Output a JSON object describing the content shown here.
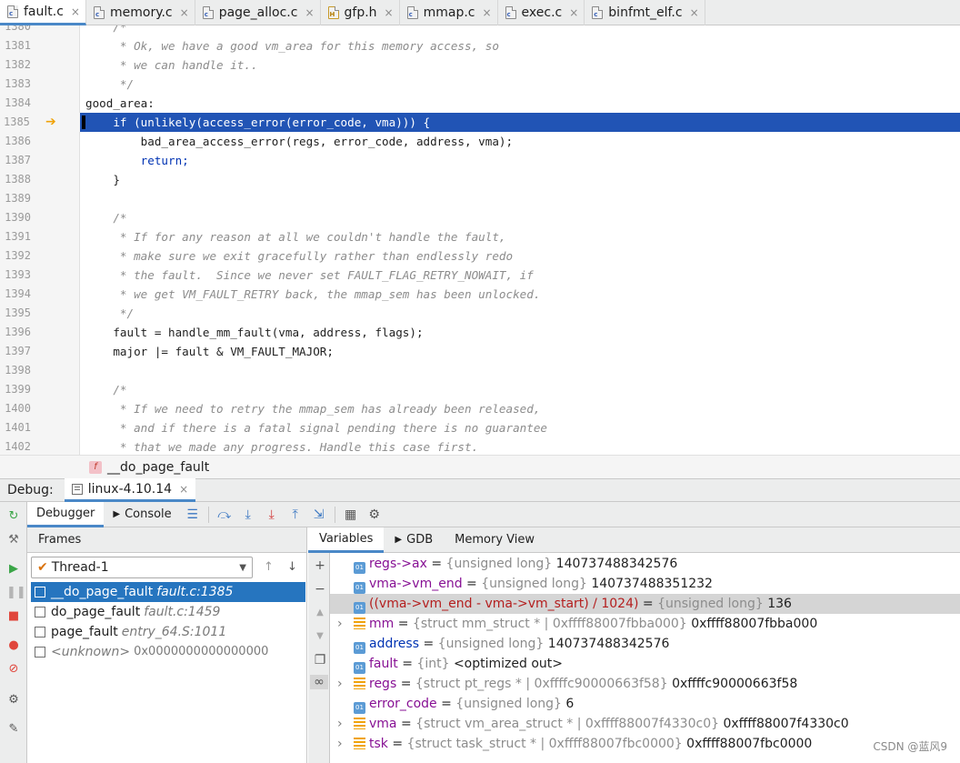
{
  "tabs": [
    {
      "label": "fault.c",
      "icon": "c-file-icon",
      "active": true
    },
    {
      "label": "memory.c",
      "icon": "c-file-icon"
    },
    {
      "label": "page_alloc.c",
      "icon": "c-file-icon"
    },
    {
      "label": "gfp.h",
      "icon": "h-file-icon"
    },
    {
      "label": "mmap.c",
      "icon": "c-file-icon"
    },
    {
      "label": "exec.c",
      "icon": "c-file-icon"
    },
    {
      "label": "binfmt_elf.c",
      "icon": "c-file-icon"
    }
  ],
  "tab_close": "×",
  "editor": {
    "lines": [
      {
        "n": "1380",
        "text": "    /*",
        "kind": "cm"
      },
      {
        "n": "1381",
        "text": "     * Ok, we have a good vm_area for this memory access, so",
        "kind": "cm"
      },
      {
        "n": "1382",
        "text": "     * we can handle it..",
        "kind": "cm"
      },
      {
        "n": "1383",
        "text": "     */",
        "kind": "cm"
      },
      {
        "n": "1384",
        "text": "good_area:",
        "kind": "code"
      },
      {
        "n": "1385",
        "text": "    if (unlikely(access_error(error_code, vma))) {",
        "kind": "code",
        "current": true
      },
      {
        "n": "1386",
        "text": "        bad_area_access_error(regs, error_code, address, vma);",
        "kind": "code"
      },
      {
        "n": "1387",
        "text": "        return;",
        "kind": "kw"
      },
      {
        "n": "1388",
        "text": "    }",
        "kind": "code"
      },
      {
        "n": "1389",
        "text": "",
        "kind": "code"
      },
      {
        "n": "1390",
        "text": "    /*",
        "kind": "cm"
      },
      {
        "n": "1391",
        "text": "     * If for any reason at all we couldn't handle the fault,",
        "kind": "cm"
      },
      {
        "n": "1392",
        "text": "     * make sure we exit gracefully rather than endlessly redo",
        "kind": "cm"
      },
      {
        "n": "1393",
        "text": "     * the fault.  Since we never set FAULT_FLAG_RETRY_NOWAIT, if",
        "kind": "cm"
      },
      {
        "n": "1394",
        "text": "     * we get VM_FAULT_RETRY back, the mmap_sem has been unlocked.",
        "kind": "cm"
      },
      {
        "n": "1395",
        "text": "     */",
        "kind": "cm"
      },
      {
        "n": "1396",
        "text": "    fault = handle_mm_fault(vma, address, flags);",
        "kind": "code"
      },
      {
        "n": "1397",
        "text": "    major |= fault & VM_FAULT_MAJOR;",
        "kind": "code"
      },
      {
        "n": "1398",
        "text": "",
        "kind": "code"
      },
      {
        "n": "1399",
        "text": "    /*",
        "kind": "cm"
      },
      {
        "n": "1400",
        "text": "     * If we need to retry the mmap_sem has already been released,",
        "kind": "cm"
      },
      {
        "n": "1401",
        "text": "     * and if there is a fatal signal pending there is no guarantee",
        "kind": "cm"
      },
      {
        "n": "1402",
        "text": "     * that we made any progress. Handle this case first.",
        "kind": "cm"
      }
    ],
    "exec_arrow": "➔"
  },
  "breadcrumb": {
    "badge": "f",
    "label": "__do_page_fault"
  },
  "debug": {
    "title": "Debug:",
    "session": "linux-4.10.14",
    "session_close": "×",
    "tabs": {
      "debugger": "Debugger",
      "console": "Console"
    },
    "toolbar_icons": [
      "menu-icon",
      "step-over-icon",
      "step-into-icon",
      "force-step-into-icon",
      "step-out-icon",
      "run-to-cursor-icon",
      "evaluate-icon",
      "settings-icon"
    ]
  },
  "frames": {
    "header": "Frames",
    "thread": "Thread-1",
    "list": [
      {
        "func": "__do_page_fault",
        "loc": "fault.c:1385",
        "selected": true
      },
      {
        "func": "do_page_fault",
        "loc": "fault.c:1459"
      },
      {
        "func": "page_fault",
        "loc": "entry_64.S:1011"
      },
      {
        "func": "<unknown>",
        "loc": "0x0000000000000000",
        "unknown": true
      }
    ]
  },
  "variables": {
    "tabs": [
      "Variables",
      "GDB",
      "Memory View"
    ],
    "items": [
      {
        "icon": "primitive",
        "name": "regs->ax",
        "type": "{unsigned long}",
        "value": "140737488342576",
        "style": "var"
      },
      {
        "icon": "primitive",
        "name": "vma->vm_end",
        "type": "{unsigned long}",
        "value": "140737488351232",
        "style": "var"
      },
      {
        "icon": "primitive",
        "name": "((vma->vm_end - vma->vm_start) / 1024)",
        "type": "{unsigned long}",
        "value": "136",
        "style": "expr",
        "selected": true
      },
      {
        "icon": "struct",
        "name": "mm",
        "type": "{struct mm_struct * | 0xffff88007fbba000}",
        "value": "0xffff88007fbba000",
        "style": "var",
        "expandable": true
      },
      {
        "icon": "primitive",
        "name": "address",
        "type": "{unsigned long}",
        "value": "140737488342576",
        "style": "blue"
      },
      {
        "icon": "primitive",
        "name": "fault",
        "type": "{int}",
        "value": "<optimized out>",
        "style": "var"
      },
      {
        "icon": "struct",
        "name": "regs",
        "type": "{struct pt_regs * | 0xffffc90000663f58}",
        "value": "0xffffc90000663f58",
        "style": "var",
        "expandable": true
      },
      {
        "icon": "primitive",
        "name": "error_code",
        "type": "{unsigned long}",
        "value": "6",
        "style": "var"
      },
      {
        "icon": "struct",
        "name": "vma",
        "type": "{struct vm_area_struct * | 0xffff88007f4330c0}",
        "value": "0xffff88007f4330c0",
        "style": "var",
        "expandable": true
      },
      {
        "icon": "struct",
        "name": "tsk",
        "type": "{struct task_struct * | 0xffff88007fbc0000}",
        "value": "0xffff88007fbc0000",
        "style": "var",
        "expandable": true
      }
    ]
  },
  "watermark": "CSDN @蓝风9"
}
